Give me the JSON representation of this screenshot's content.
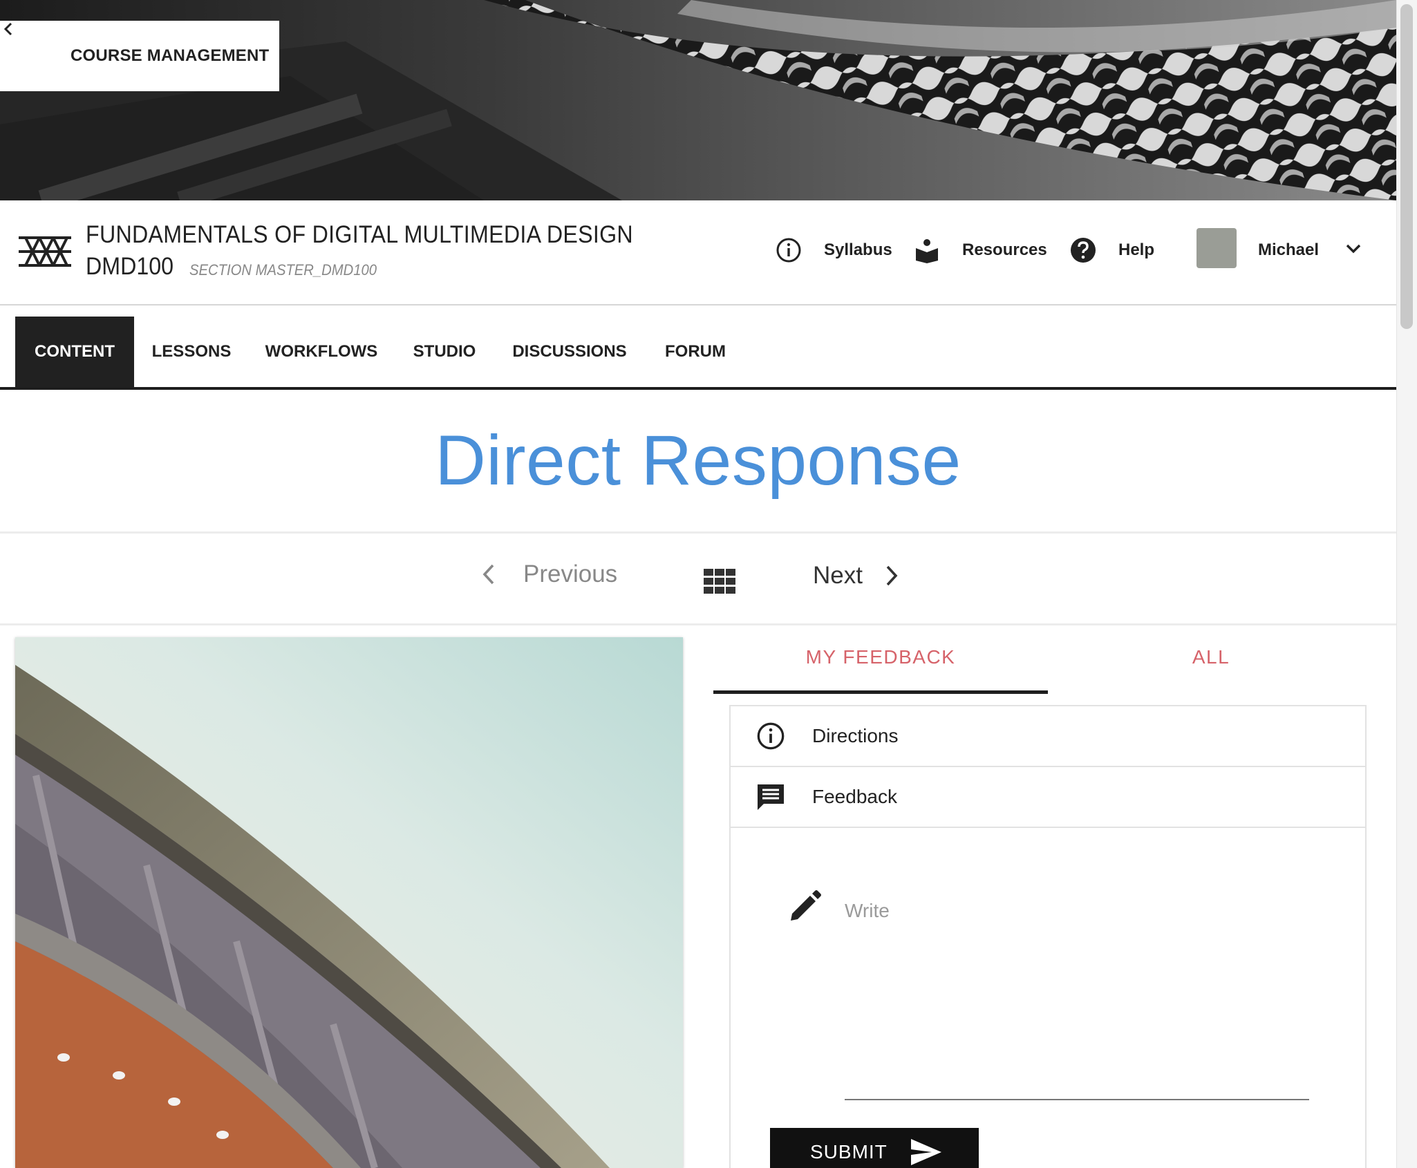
{
  "back_link": {
    "label": "COURSE MANAGEMENT",
    "icon": "chevron-left-icon"
  },
  "course": {
    "title": "FUNDAMENTALS OF DIGITAL MULTIMEDIA DESIGN",
    "code": "DMD100",
    "section": "SECTION MASTER_DMD100"
  },
  "header_nav": {
    "syllabus": {
      "label": "Syllabus",
      "icon": "info-circle-icon"
    },
    "resources": {
      "label": "Resources",
      "icon": "book-reader-icon"
    },
    "help": {
      "label": "Help",
      "icon": "help-circle-icon"
    },
    "user": {
      "name": "Michael",
      "icon": "chevron-down-icon"
    }
  },
  "tabs": [
    {
      "label": "CONTENT",
      "active": true
    },
    {
      "label": "LESSONS",
      "active": false
    },
    {
      "label": "WORKFLOWS",
      "active": false
    },
    {
      "label": "STUDIO",
      "active": false
    },
    {
      "label": "DISCUSSIONS",
      "active": false
    },
    {
      "label": "FORUM",
      "active": false
    }
  ],
  "page": {
    "title": "Direct Response"
  },
  "pager": {
    "previous": "Previous",
    "next": "Next"
  },
  "feedback": {
    "tabs": [
      {
        "label": "MY FEEDBACK",
        "active": true
      },
      {
        "label": "ALL",
        "active": false
      }
    ],
    "rows": [
      {
        "label": "Directions",
        "icon": "info-circle-icon"
      },
      {
        "label": "Feedback",
        "icon": "comment-icon"
      }
    ],
    "write_placeholder": "Write",
    "write_value": "",
    "submit_label": "SUBMIT"
  },
  "colors": {
    "accent_blue": "#4a90d9",
    "feedback_tab_red": "#d6636a",
    "active_tab_bg": "#212121"
  }
}
